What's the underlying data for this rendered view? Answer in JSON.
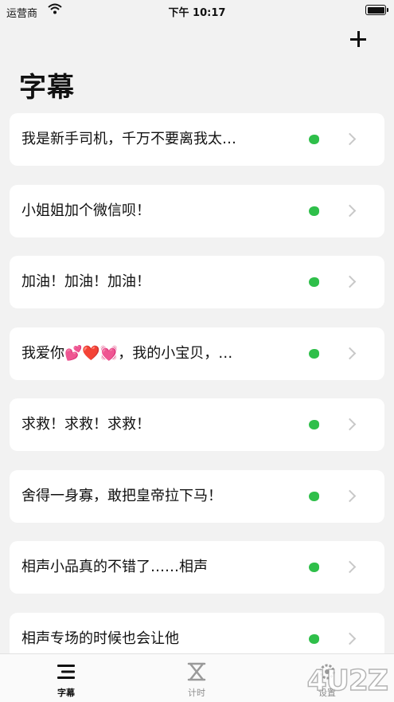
{
  "status_bar": {
    "carrier": "运营商",
    "time": "下午 10:17"
  },
  "header": {
    "title": "字幕"
  },
  "items": [
    {
      "text": "我是新手司机，千万不要离我太…"
    },
    {
      "text": "小姐姐加个微信呗！"
    },
    {
      "text": "加油！加油！加油！"
    },
    {
      "text": "我爱你💕❤️💓，我的小宝贝，…"
    },
    {
      "text": "求救！求救！求救！"
    },
    {
      "text": "舍得一身寡，敢把皇帝拉下马！"
    },
    {
      "text": "相声小品真的不错了……相声"
    },
    {
      "text": "相声专场的时候也会让他"
    }
  ],
  "tabs": [
    {
      "label": "字幕",
      "icon": "subtitles-icon",
      "active": true
    },
    {
      "label": "计时",
      "icon": "hourglass-icon",
      "active": false
    },
    {
      "label": "设置",
      "icon": "gear-icon",
      "active": false
    }
  ],
  "colors": {
    "background": "#f2f2f2",
    "card": "#ffffff",
    "status_dot": "#2fbf4a",
    "chevron": "#c8c8c8"
  },
  "watermark": "4U2Z"
}
